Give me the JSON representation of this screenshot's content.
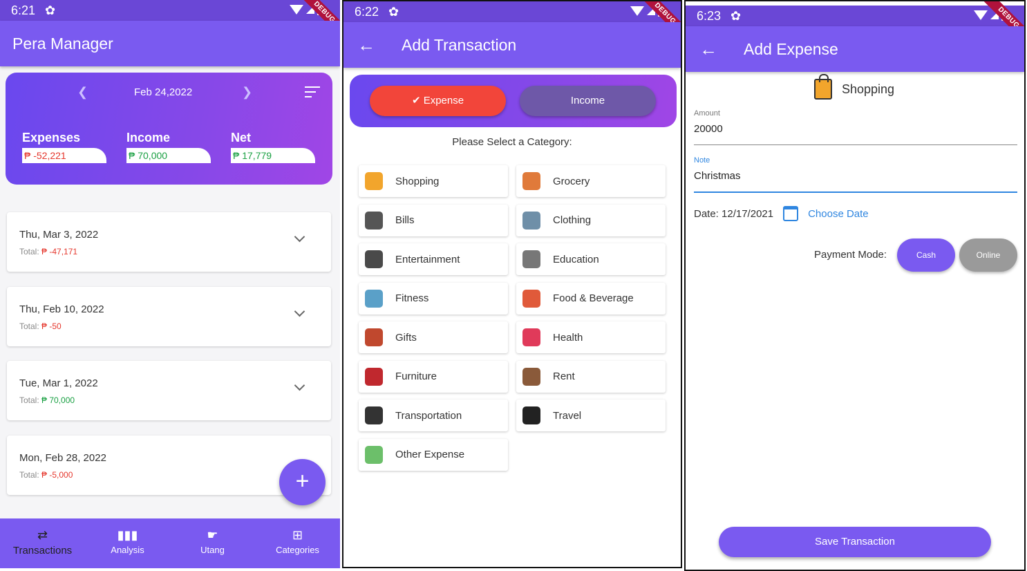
{
  "screen1": {
    "status": {
      "time": "6:21"
    },
    "debug_label": "DEBUG",
    "app_title": "Pera Manager",
    "summary": {
      "date": "Feb 24,2022",
      "expenses_label": "Expenses",
      "expenses_value": "₱ -52,221",
      "income_label": "Income",
      "income_value": "₱ 70,000",
      "net_label": "Net",
      "net_value": "₱ 17,779"
    },
    "days": [
      {
        "date": "Thu, Mar 3, 2022",
        "total_label": "Total:",
        "total": "₱ -47,171",
        "status": "neg"
      },
      {
        "date": "Thu, Feb 10, 2022",
        "total_label": "Total:",
        "total": "₱ -50",
        "status": "neg"
      },
      {
        "date": "Tue, Mar 1, 2022",
        "total_label": "Total:",
        "total": "₱ 70,000",
        "status": "pos"
      },
      {
        "date": "Mon, Feb 28, 2022",
        "total_label": "Total:",
        "total": "₱ -5,000",
        "status": "neg"
      }
    ],
    "fab_label": "+",
    "nav": [
      {
        "label": "Transactions",
        "icon": "transactions-icon"
      },
      {
        "label": "Analysis",
        "icon": "bar-chart-icon"
      },
      {
        "label": "Utang",
        "icon": "hand-money-icon"
      },
      {
        "label": "Categories",
        "icon": "categories-icon"
      }
    ]
  },
  "screen2": {
    "status": {
      "time": "6:22"
    },
    "debug_label": "DEBUG",
    "app_title": "Add Transaction",
    "expense_label": "Expense",
    "income_label": "Income",
    "prompt": "Please Select a Category:",
    "categories": [
      {
        "label": "Shopping",
        "icon": "shopping-bag-icon",
        "color": "#f2a52c"
      },
      {
        "label": "Grocery",
        "icon": "grocery-icon",
        "color": "#e07a3a"
      },
      {
        "label": "Bills",
        "icon": "bills-icon",
        "color": "#555555"
      },
      {
        "label": "Clothing",
        "icon": "clothing-icon",
        "color": "#6f8fa8"
      },
      {
        "label": "Entertainment",
        "icon": "monitor-icon",
        "color": "#4a4a4a"
      },
      {
        "label": "Education",
        "icon": "graduation-cap-icon",
        "color": "#777777"
      },
      {
        "label": "Fitness",
        "icon": "fitness-icon",
        "color": "#5aa0c8"
      },
      {
        "label": "Food & Beverage",
        "icon": "food-icon",
        "color": "#e05a3a"
      },
      {
        "label": "Gifts",
        "icon": "gift-icon",
        "color": "#c0482e"
      },
      {
        "label": "Health",
        "icon": "heart-icon",
        "color": "#e03a5a"
      },
      {
        "label": "Furniture",
        "icon": "chair-icon",
        "color": "#c0282e"
      },
      {
        "label": "Rent",
        "icon": "sign-icon",
        "color": "#8a5a3a"
      },
      {
        "label": "Transportation",
        "icon": "car-icon",
        "color": "#333333"
      },
      {
        "label": "Travel",
        "icon": "travelers-icon",
        "color": "#222222"
      },
      {
        "label": "Other Expense",
        "icon": "cash-icon",
        "color": "#6cbf6a"
      }
    ]
  },
  "screen3": {
    "status": {
      "time": "6:23"
    },
    "debug_label": "DEBUG",
    "app_title": "Add Expense",
    "category": "Shopping",
    "amount_label": "Amount",
    "amount_value": "20000",
    "note_label": "Note",
    "note_value": "Christmas",
    "date_text": "Date: 12/17/2021",
    "choose_date": "Choose Date",
    "payment_label": "Payment Mode:",
    "cash_label": "Cash",
    "online_label": "Online",
    "save_label": "Save Transaction"
  }
}
